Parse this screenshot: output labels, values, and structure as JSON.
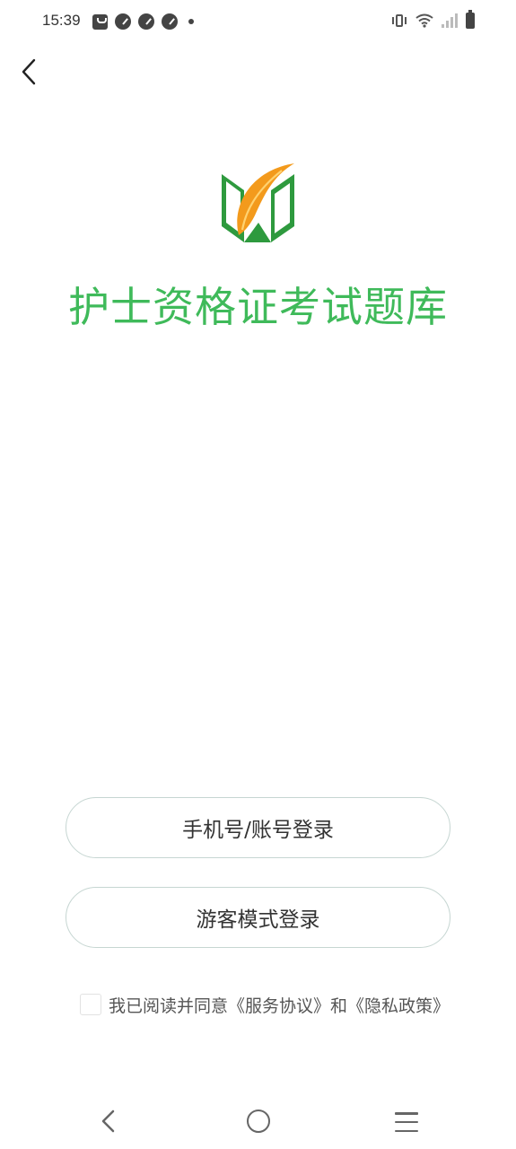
{
  "status_bar": {
    "time": "15:39",
    "left_icons": [
      "shopping-bag-icon",
      "gauge-icon",
      "gauge-icon",
      "gauge-icon",
      "dot-icon"
    ],
    "right_icons": [
      "vibrate-icon",
      "wifi-icon",
      "signal-icon",
      "battery-icon"
    ]
  },
  "header": {
    "back_icon": "chevron-left-icon"
  },
  "app": {
    "title": "护士资格证考试题库",
    "title_color": "#3fba5a",
    "logo_icon": "book-leaf-logo-icon"
  },
  "buttons": {
    "phone_login_label": "手机号/账号登录",
    "guest_login_label": "游客模式登录"
  },
  "agreement": {
    "checked": false,
    "text_prefix": "我已阅读并同意",
    "service_link": "《服务协议》",
    "conjunction": "和",
    "privacy_link": "《隐私政策》"
  },
  "nav_bar": {
    "icons": [
      "nav-back-icon",
      "nav-home-icon",
      "nav-menu-icon"
    ]
  },
  "colors": {
    "accent_green": "#3fba5a",
    "logo_green": "#2e9a3e",
    "logo_orange": "#f39a1c"
  }
}
